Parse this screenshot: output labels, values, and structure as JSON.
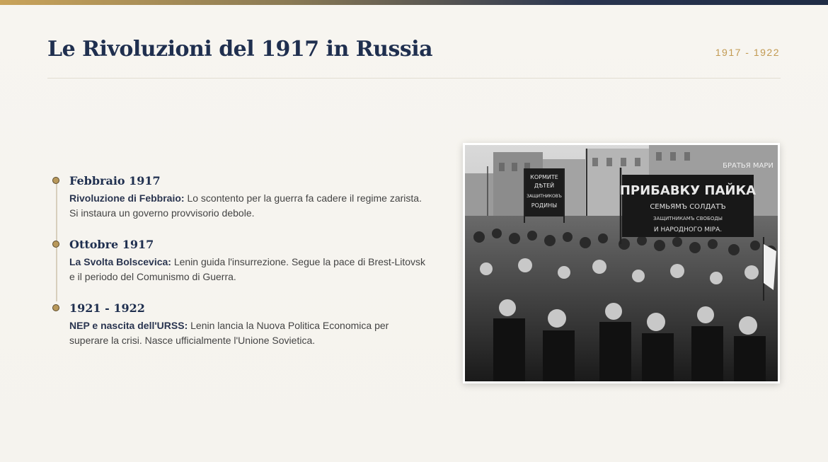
{
  "header": {
    "title": "Le Rivoluzioni del 1917 in Russia",
    "years": "1917 - 1922"
  },
  "timeline": [
    {
      "date": "Febbraio 1917",
      "lead": "Rivoluzione di Febbraio:",
      "text": " Lo scontento per la guerra fa cadere il regime zarista. Si instaura un governo provvisorio debole."
    },
    {
      "date": "Ottobre 1917",
      "lead": "La Svolta Bolscevica:",
      "text": " Lenin guida l'insurrezione. Segue la pace di Brest-Litovsk e il periodo del Comunismo di Guerra."
    },
    {
      "date": "1921 - 1922",
      "lead": "NEP e nascita dell'URSS:",
      "text": " Lenin lancia la Nuova Politica Economica per superare la crisi. Nasce ufficialmente l'Unione Sovietica."
    }
  ],
  "photo": {
    "banner_main_line1": "ПРИБАВКУ ПАЙКА",
    "banner_main_line2": "СЕМЬЯМЪ СОЛДАТЪ",
    "banner_main_line3": "ЗАЩИТНИКАМЪ СВОБОДЫ",
    "banner_main_line4": "И НАРОДНОГО МІРА.",
    "banner_small_line1": "КОРМИТЕ",
    "banner_small_line2": "ДѢТЕЙ",
    "banner_small_line3": "ЗАЩИТНИКОВЪ",
    "banner_small_line4": "РОДИНЫ",
    "shop_sign": "БРАТЬЯ МАРИ"
  }
}
